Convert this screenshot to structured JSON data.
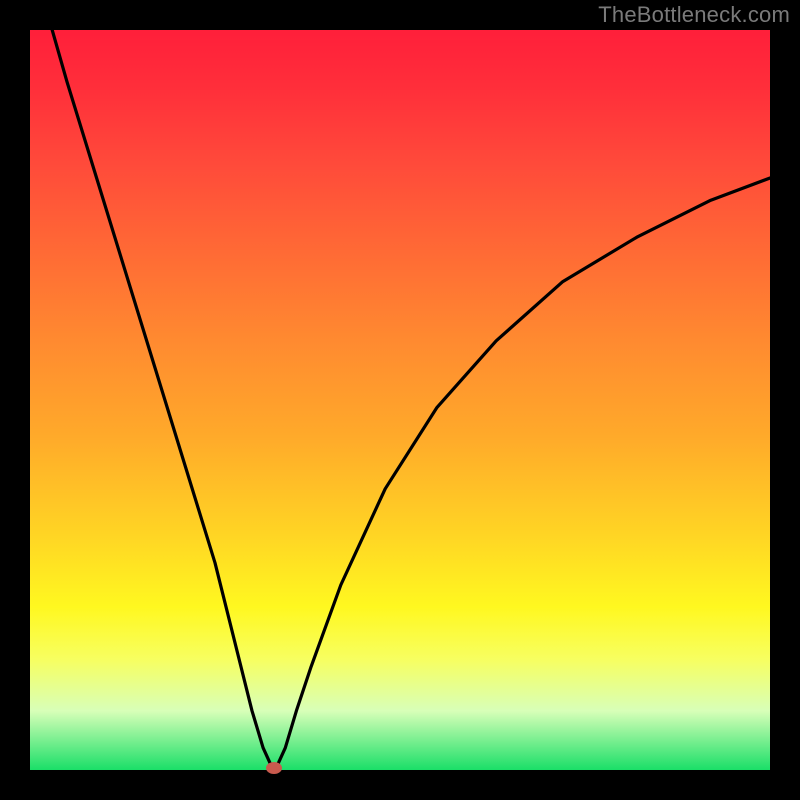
{
  "watermark": "TheBottleneck.com",
  "chart_data": {
    "type": "line",
    "title": "",
    "xlabel": "",
    "ylabel": "",
    "xlim": [
      0,
      100
    ],
    "ylim": [
      0,
      100
    ],
    "grid": false,
    "legend": false,
    "series": [
      {
        "name": "curve",
        "x": [
          3,
          5,
          9,
          13,
          17,
          21,
          25,
          28,
          30,
          31.5,
          32.5,
          33,
          33.5,
          34.5,
          36,
          38,
          42,
          48,
          55,
          63,
          72,
          82,
          92,
          100
        ],
        "y": [
          100,
          93,
          80,
          67,
          54,
          41,
          28,
          16,
          8,
          3,
          0.8,
          0.3,
          0.8,
          3,
          8,
          14,
          25,
          38,
          49,
          58,
          66,
          72,
          77,
          80
        ]
      }
    ],
    "marker": {
      "x": 33,
      "y": 0.3
    },
    "background_gradient": {
      "top": "#ff1f3a",
      "mid": "#ffd424",
      "bottom": "#1adf68"
    }
  }
}
